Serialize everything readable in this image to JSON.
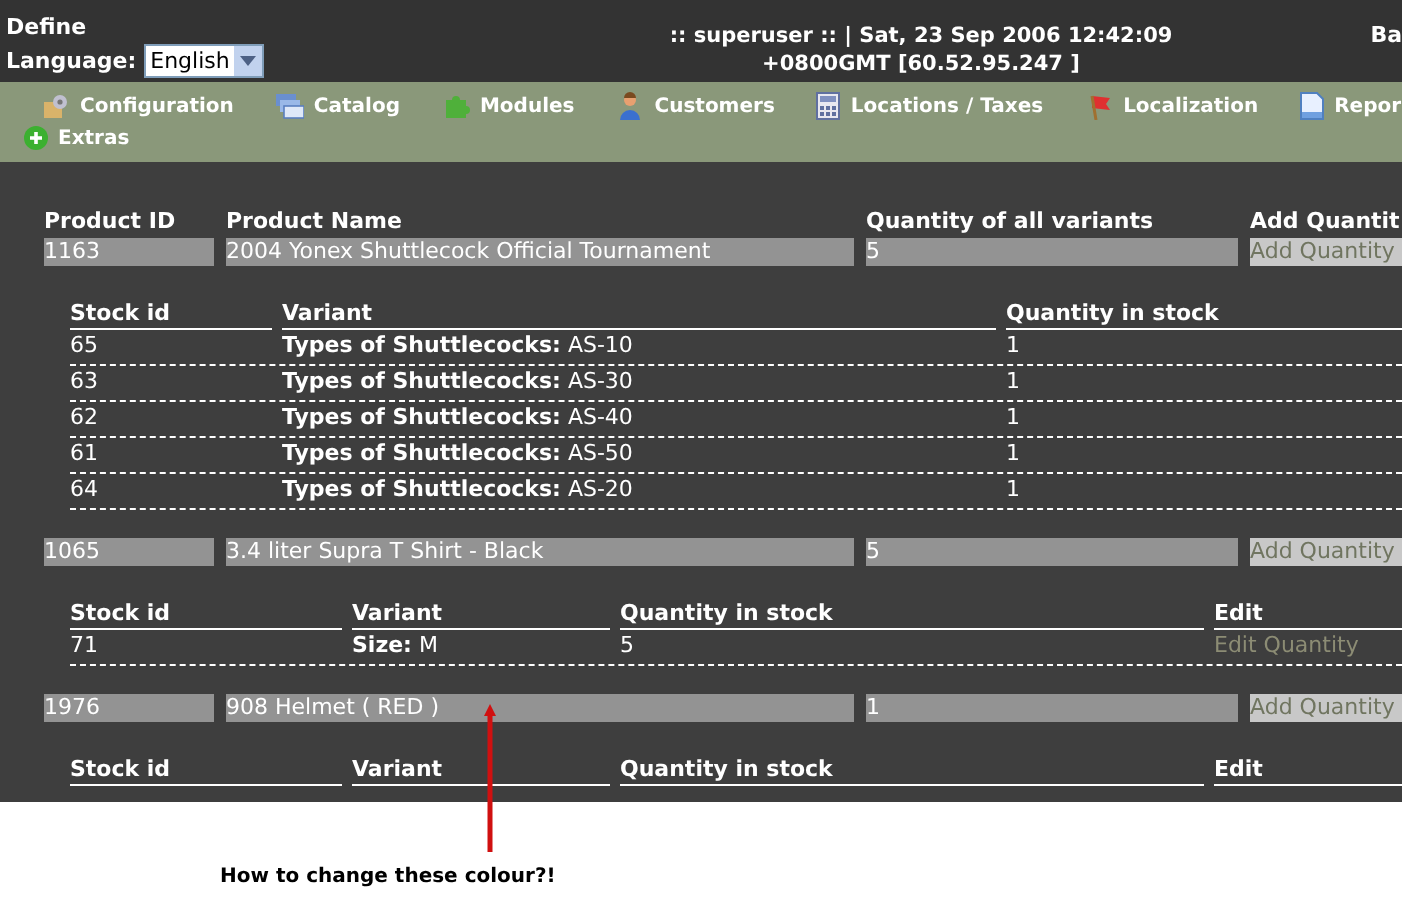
{
  "header": {
    "brand": "Define",
    "language_label": "Language:",
    "language_value": "English",
    "session_line_1": ":: superuser :: | Sat, 23 Sep 2006 12:42:09",
    "session_line_2": "+0800GMT [60.52.95.247 ]",
    "right_text": "Ba"
  },
  "nav": {
    "rows": [
      [
        {
          "label": "Configuration"
        },
        {
          "label": "Catalog"
        },
        {
          "label": "Modules"
        },
        {
          "label": "Customers"
        },
        {
          "label": "Locations / Taxes"
        },
        {
          "label": "Localization"
        },
        {
          "label": "Repor"
        }
      ],
      [
        {
          "label": "Extras"
        }
      ]
    ]
  },
  "products_table": {
    "columns": [
      "Product ID",
      "Product Name",
      "Quantity of all variants",
      "Add Quantit"
    ]
  },
  "products": [
    {
      "id": "1163",
      "name": "2004 Yonex Shuttlecock Official Tournament",
      "quantity": "5",
      "action": "Add Quantity",
      "stock": {
        "columns": [
          "Stock id",
          "Variant",
          "Quantity in stock"
        ],
        "rows": [
          {
            "stock_id": "65",
            "variant_label": "Types of Shuttlecocks:",
            "variant_value": "AS-10",
            "quantity": "1"
          },
          {
            "stock_id": "63",
            "variant_label": "Types of Shuttlecocks:",
            "variant_value": "AS-30",
            "quantity": "1"
          },
          {
            "stock_id": "62",
            "variant_label": "Types of Shuttlecocks:",
            "variant_value": "AS-40",
            "quantity": "1"
          },
          {
            "stock_id": "61",
            "variant_label": "Types of Shuttlecocks:",
            "variant_value": "AS-50",
            "quantity": "1"
          },
          {
            "stock_id": "64",
            "variant_label": "Types of Shuttlecocks:",
            "variant_value": "AS-20",
            "quantity": "1"
          }
        ]
      }
    },
    {
      "id": "1065",
      "name": "3.4 liter Supra T Shirt - Black",
      "quantity": "5",
      "action": "Add Quantity",
      "stock": {
        "columns": [
          "Stock id",
          "Variant",
          "Quantity in stock",
          "Edit"
        ],
        "rows": [
          {
            "stock_id": "71",
            "variant_label": "Size:",
            "variant_value": "M",
            "quantity": "5",
            "action": "Edit Quantity"
          }
        ]
      }
    },
    {
      "id": "1976",
      "name": "908 Helmet ( RED )",
      "quantity": "1",
      "action": "Add Quantity",
      "stock": {
        "columns": [
          "Stock id",
          "Variant",
          "Quantity in stock",
          "Edit"
        ]
      }
    }
  ],
  "annotation": {
    "text": "How to change these colour?!"
  }
}
